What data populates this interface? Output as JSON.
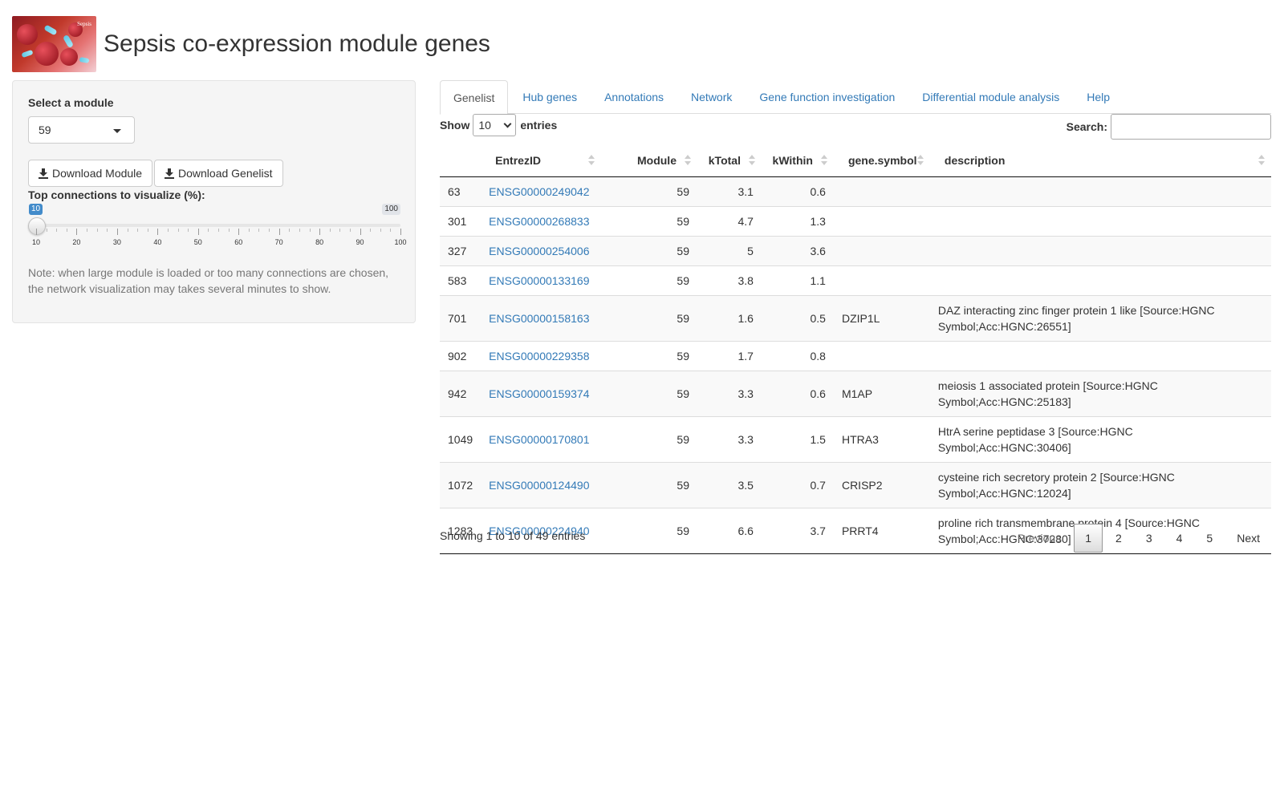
{
  "header": {
    "title": "Sepsis co-expression module genes",
    "logo_text": "Sepsis"
  },
  "sidebar": {
    "select_label": "Select a module",
    "selected_module": "59",
    "download_module_label": "Download Module",
    "download_genelist_label": "Download Genelist",
    "slider_label": "Top connections to visualize (%):",
    "slider": {
      "value": "10",
      "max": "100",
      "ticks": [
        "10",
        "20",
        "30",
        "40",
        "50",
        "60",
        "70",
        "80",
        "90",
        "100"
      ]
    },
    "note": "Note: when large module is loaded or too many connections are chosen, the network visualization may takes several minutes to show."
  },
  "tabs": [
    {
      "label": "Genelist",
      "active": true
    },
    {
      "label": "Hub genes"
    },
    {
      "label": "Annotations"
    },
    {
      "label": "Network"
    },
    {
      "label": "Gene function investigation"
    },
    {
      "label": "Differential module analysis"
    },
    {
      "label": "Help"
    }
  ],
  "table": {
    "show_label": "Show",
    "entries_label": "entries",
    "page_length": "10",
    "search_label": "Search:",
    "search_value": "",
    "columns": [
      "",
      "EntrezID",
      "Module",
      "kTotal",
      "kWithin",
      "gene.symbol",
      "description"
    ],
    "rows": [
      {
        "idx": "63",
        "id": "ENSG00000249042",
        "module": "59",
        "ktotal": "3.1",
        "kwithin": "0.6",
        "symbol": "",
        "desc": ""
      },
      {
        "idx": "301",
        "id": "ENSG00000268833",
        "module": "59",
        "ktotal": "4.7",
        "kwithin": "1.3",
        "symbol": "",
        "desc": ""
      },
      {
        "idx": "327",
        "id": "ENSG00000254006",
        "module": "59",
        "ktotal": "5",
        "kwithin": "3.6",
        "symbol": "",
        "desc": ""
      },
      {
        "idx": "583",
        "id": "ENSG00000133169",
        "module": "59",
        "ktotal": "3.8",
        "kwithin": "1.1",
        "symbol": "",
        "desc": ""
      },
      {
        "idx": "701",
        "id": "ENSG00000158163",
        "module": "59",
        "ktotal": "1.6",
        "kwithin": "0.5",
        "symbol": "DZIP1L",
        "desc": "DAZ interacting zinc finger protein 1 like [Source:HGNC Symbol;Acc:HGNC:26551]"
      },
      {
        "idx": "902",
        "id": "ENSG00000229358",
        "module": "59",
        "ktotal": "1.7",
        "kwithin": "0.8",
        "symbol": "",
        "desc": ""
      },
      {
        "idx": "942",
        "id": "ENSG00000159374",
        "module": "59",
        "ktotal": "3.3",
        "kwithin": "0.6",
        "symbol": "M1AP",
        "desc": "meiosis 1 associated protein [Source:HGNC Symbol;Acc:HGNC:25183]"
      },
      {
        "idx": "1049",
        "id": "ENSG00000170801",
        "module": "59",
        "ktotal": "3.3",
        "kwithin": "1.5",
        "symbol": "HTRA3",
        "desc": "HtrA serine peptidase 3 [Source:HGNC Symbol;Acc:HGNC:30406]"
      },
      {
        "idx": "1072",
        "id": "ENSG00000124490",
        "module": "59",
        "ktotal": "3.5",
        "kwithin": "0.7",
        "symbol": "CRISP2",
        "desc": "cysteine rich secretory protein 2 [Source:HGNC Symbol;Acc:HGNC:12024]"
      },
      {
        "idx": "1283",
        "id": "ENSG00000224940",
        "module": "59",
        "ktotal": "6.6",
        "kwithin": "3.7",
        "symbol": "PRRT4",
        "desc": "proline rich transmembrane protein 4 [Source:HGNC Symbol;Acc:HGNC:37280]"
      }
    ],
    "info": "Showing 1 to 10 of 49 entries",
    "pagination": {
      "previous": "Previous",
      "pages": [
        "1",
        "2",
        "3",
        "4",
        "5"
      ],
      "current": "1",
      "next": "Next"
    }
  },
  "colors": {
    "link": "#337ab7",
    "slider_accent": "#428bca",
    "well_bg": "#f5f5f5"
  },
  "icons": {
    "download": "download-icon",
    "dropdown": "chevron-down-icon",
    "sort": "sort-icon"
  }
}
